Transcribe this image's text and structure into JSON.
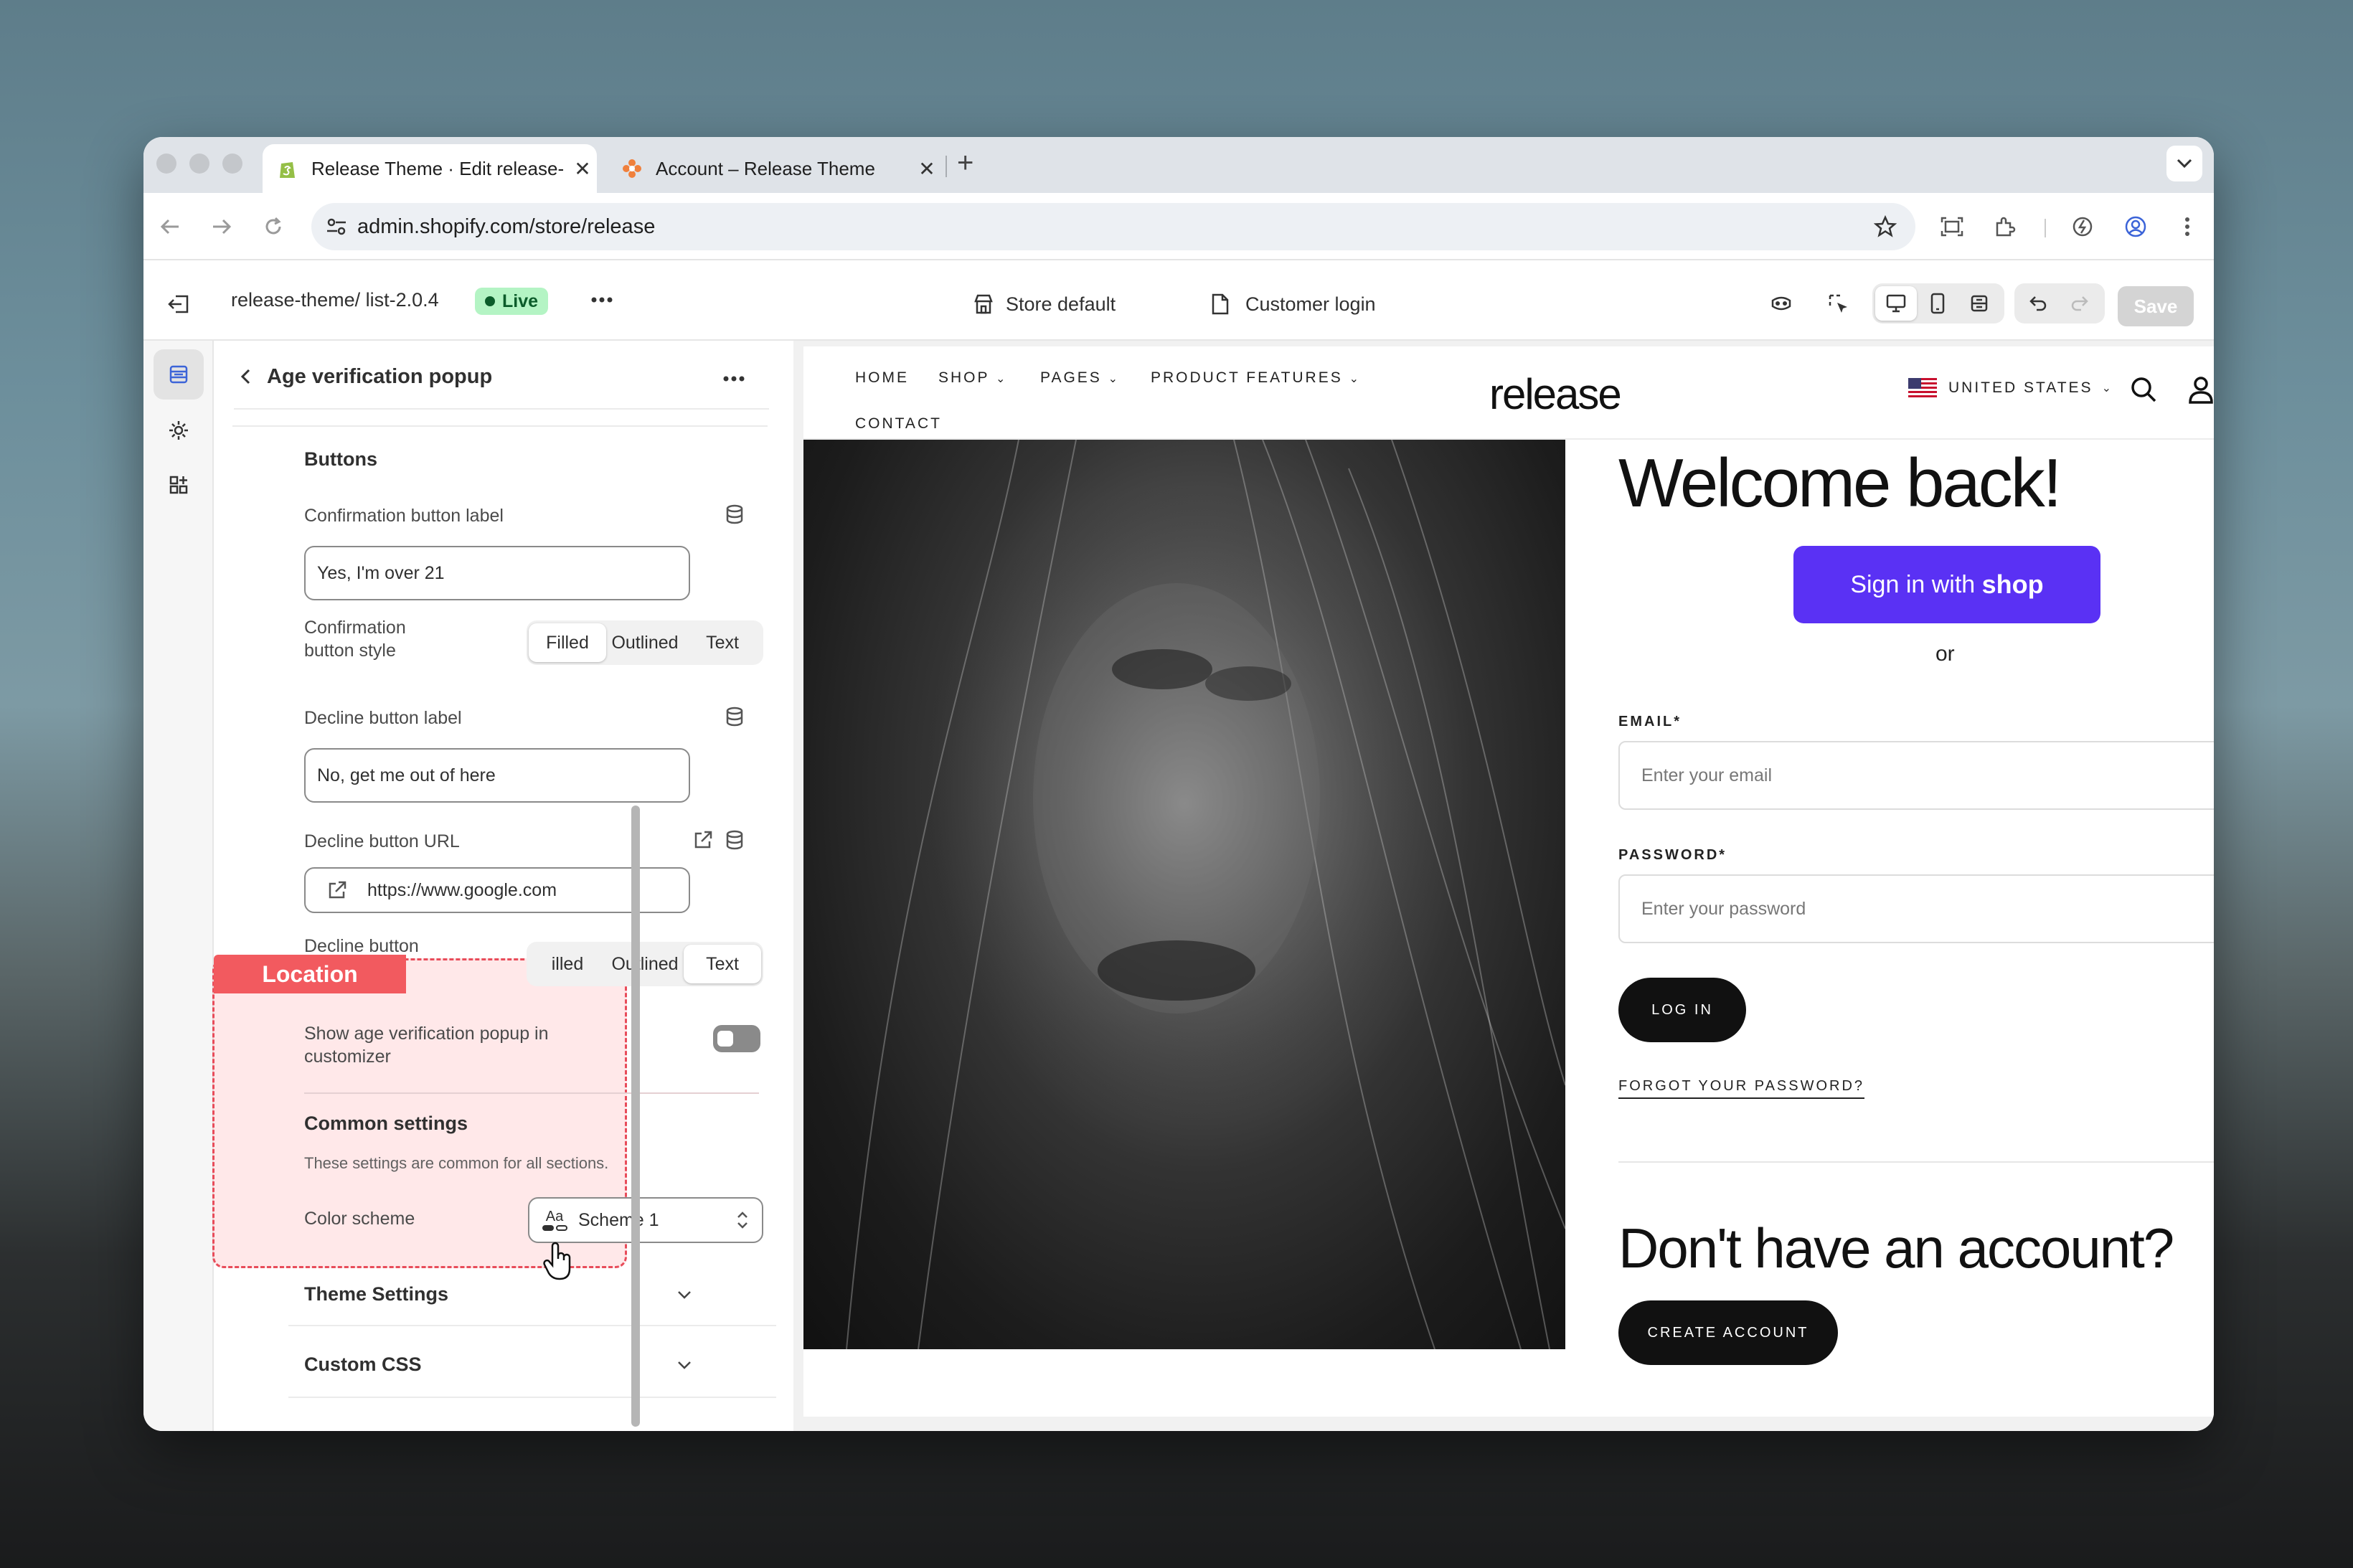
{
  "browser": {
    "tabs": [
      {
        "label": "Release Theme · Edit release-",
        "active": true
      },
      {
        "label": "Account – Release Theme",
        "active": false
      }
    ],
    "url": "admin.shopify.com/store/release"
  },
  "appbar": {
    "theme_path": "release-theme/ list-2.0.4",
    "live_label": "Live",
    "store_default": "Store default",
    "customer_login": "Customer login",
    "save_label": "Save"
  },
  "panel": {
    "title": "Age verification popup",
    "buttons_heading": "Buttons",
    "confirm_label_title": "Confirmation button label",
    "confirm_label_value": "Yes, I'm over 21",
    "confirm_style_title_1": "Confirmation",
    "confirm_style_title_2": "button style",
    "style_options": [
      "Filled",
      "Outlined",
      "Text"
    ],
    "confirm_style_selected": "Filled",
    "decline_label_title": "Decline button label",
    "decline_label_value": "No, get me out of here",
    "decline_url_title": "Decline button URL",
    "decline_url_value": "https://www.google.com",
    "decline_style_title": "Decline button",
    "decline_style_options": [
      "illed",
      "Outlined",
      "Text"
    ],
    "decline_style_selected": "Text",
    "location_tag": "Location",
    "show_popup_1": "Show age verification popup in",
    "show_popup_2": "customizer",
    "common_heading": "Common settings",
    "common_desc": "These settings are common for all sections.",
    "color_scheme_label": "Color scheme",
    "color_scheme_icon_text": "Aa",
    "color_scheme_value": "Scheme 1",
    "theme_settings": "Theme Settings",
    "custom_css": "Custom CSS"
  },
  "store": {
    "nav": [
      "HOME",
      "SHOP",
      "PAGES",
      "PRODUCT FEATURES",
      "CONTACT"
    ],
    "logo": "release",
    "country": "UNITED STATES",
    "welcome": "Welcome back!",
    "shop_btn_prefix": "Sign in with ",
    "shop_btn_brand": "shop",
    "or": "or",
    "email_label": "EMAIL*",
    "email_placeholder": "Enter your email",
    "password_label": "PASSWORD*",
    "password_placeholder": "Enter your password",
    "login": "LOG IN",
    "forgot": "FORGOT YOUR PASSWORD?",
    "no_account": "Don't have an account?",
    "create": "CREATE ACCOUNT"
  },
  "colors": {
    "shop_purple": "#5a31f4",
    "live_green": "#b4f4c4",
    "highlight_red": "#f25a5f"
  }
}
